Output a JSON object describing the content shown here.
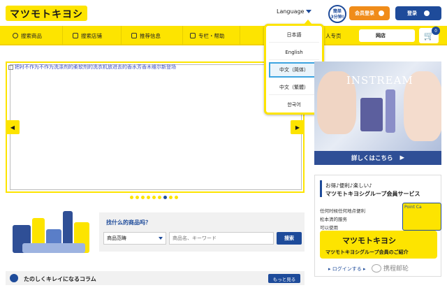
{
  "header": {
    "logo_text": "マツモトキヨシ",
    "language_label": "Language",
    "badge_line1": "簡単",
    "badge_line2": "3分钟!",
    "member_register_label": "会员登录",
    "login_label": "登录"
  },
  "nav": {
    "items": [
      {
        "label": "搜索商品"
      },
      {
        "label": "搜索店铺"
      },
      {
        "label": "推荐信息"
      },
      {
        "label": "专栏・帮助"
      },
      {
        "label": "人专页"
      }
    ],
    "store_label": "网店",
    "cart_count": "0"
  },
  "language_dropdown": {
    "items": [
      "日本語",
      "English",
      "中文（简体）",
      "中文（繁體）",
      "한국어"
    ],
    "selected_index": 2
  },
  "slider": {
    "broken_image_alt": "把衬不作为不作为洗涤剂的柔软剂的洗衣机放进去的香水芳香木维尔新登场",
    "prev_arrow": "◀",
    "next_arrow": "▶",
    "dot_count": 9,
    "active_dot": 6
  },
  "ad": {
    "brand": "INSTREAM",
    "cta": "詳しくはこちら",
    "cta_arrow": "▶"
  },
  "member_service": {
    "line1": "お得♪便利♪楽しい♪",
    "line2": "マツモトキヨシグループ会員サービス",
    "list": [
      "任何时候任何地点便利",
      "松本清的服务",
      "可以使用"
    ],
    "card_text": "Point Ca",
    "logo_text": "マツモトキヨシ",
    "logo_sub": "マツモトキヨシグループ会員のご紹介",
    "login_link": "▸ ログインする ▸",
    "watermark": "携程邮轮"
  },
  "search": {
    "question": "找什么的商品吗？",
    "category_value": "商品范畴",
    "placeholder": "商品名、キーワード",
    "button_label": "搜索"
  },
  "column": {
    "title": "たのしくキレイになるコラム",
    "more_label": "もっと見る"
  },
  "colors": {
    "brand_yellow": "#fde400",
    "brand_blue": "#1e4b9a",
    "accent_orange": "#f08c1a"
  }
}
